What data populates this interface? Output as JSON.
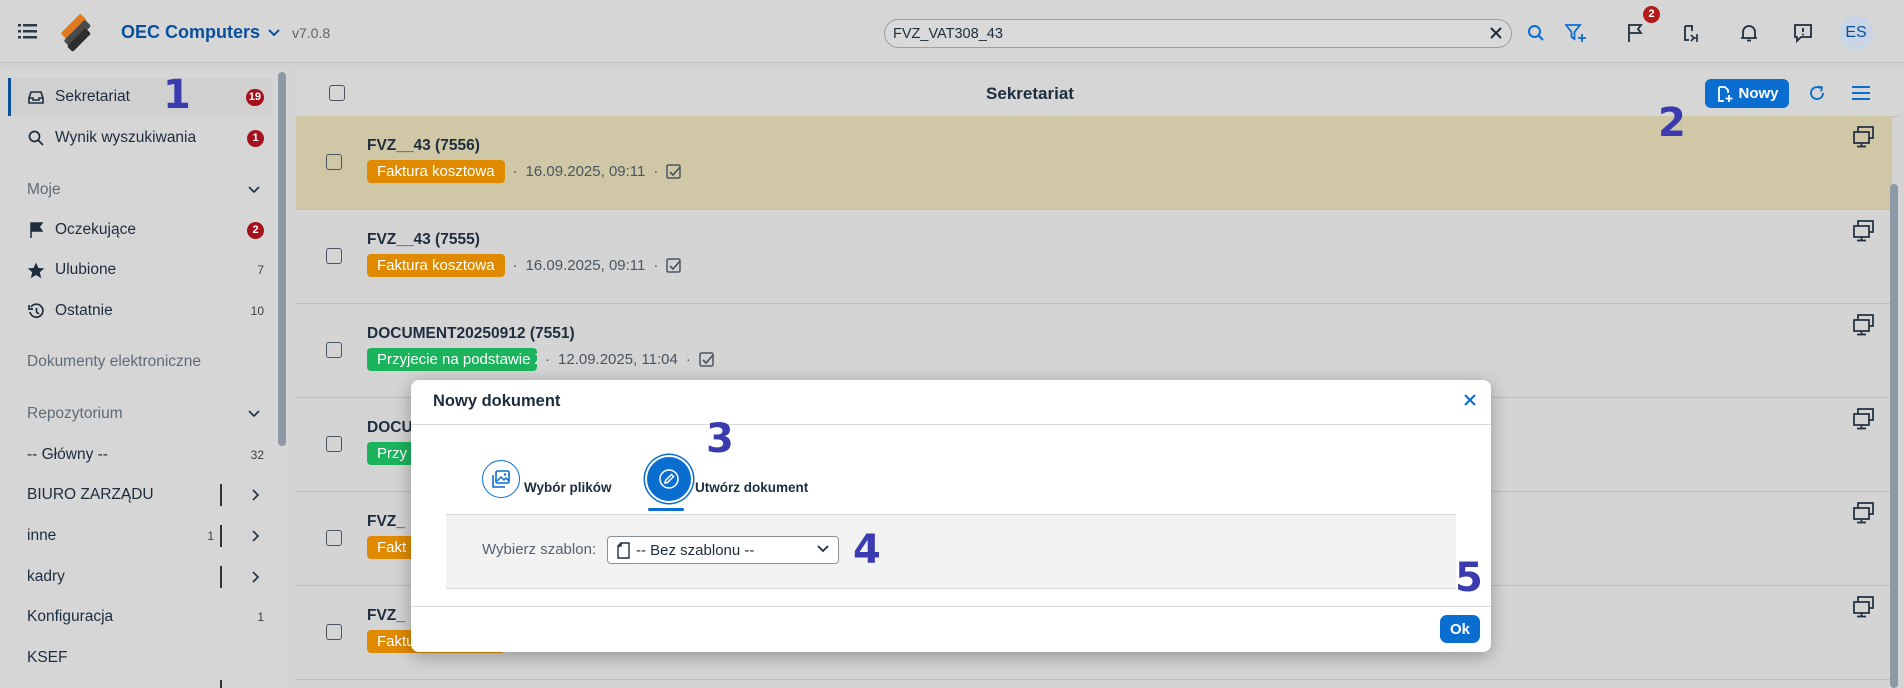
{
  "topbar": {
    "company": "OEC Computers",
    "version": "v7.0.8",
    "search_value": "FVZ_VAT308_43",
    "notification_badge": "2",
    "avatar": "ES",
    "icons": [
      "menu-list-icon",
      "app-logo-icon",
      "chevron-down-icon",
      "clear-icon",
      "search-icon",
      "filter-add-icon",
      "flag-icon",
      "process-icon",
      "bell-icon",
      "feedback-icon"
    ]
  },
  "sidebar": {
    "items": [
      {
        "label": "Sekretariat",
        "badge": "19"
      },
      {
        "label": "Wynik wyszukiwania",
        "badge": "1"
      },
      {
        "label": "Moje"
      },
      {
        "label": "Oczekujące",
        "badge": "2"
      },
      {
        "label": "Ulubione",
        "count": "7"
      },
      {
        "label": "Ostatnie",
        "count": "10"
      },
      {
        "label": "Dokumenty elektroniczne"
      },
      {
        "label": "Repozytorium"
      },
      {
        "label": "-- Główny --",
        "count": "32"
      },
      {
        "label": "BIURO ZARZĄDU"
      },
      {
        "label": "inne",
        "count": "1"
      },
      {
        "label": "kadry"
      },
      {
        "label": "Konfiguracja",
        "count": "1"
      },
      {
        "label": "KSEF"
      }
    ]
  },
  "main": {
    "title": "Sekretariat",
    "new_button": "Nowy",
    "rows": [
      {
        "title": "FVZ__43 (7556)",
        "tag": "Faktura kosztowa",
        "date": "16.09.2025, 09:11"
      },
      {
        "title": "FVZ__43 (7555)",
        "tag": "Faktura kosztowa",
        "date": "16.09.2025, 09:11"
      },
      {
        "title": "DOCUMENT20250912 (7551)",
        "tag": "Przyjecie na podstawie Zam...",
        "date": "12.09.2025, 11:04"
      },
      {
        "title": "DOCU",
        "tag": "Przy"
      },
      {
        "title": "FVZ_",
        "tag": "Fakt"
      },
      {
        "title": "FVZ_",
        "tag": "Faktura kosztowa"
      }
    ],
    "separator": "·"
  },
  "dialog": {
    "title": "Nowy dokument",
    "tabs": [
      {
        "label": "Wybór plików"
      },
      {
        "label": "Utwórz dokument"
      }
    ],
    "template_label": "Wybierz szablon:",
    "template_value": "-- Bez szablonu --",
    "ok": "Ok"
  },
  "annotations": [
    "1",
    "2",
    "3",
    "4",
    "5"
  ],
  "colors": {
    "accent": "#0a6ed1",
    "brand": "#0a4f9c",
    "badge": "#a5121f",
    "tag_orange": "#e08a00",
    "tag_green": "#1bb45c",
    "selected_row": "#cfc7a6",
    "annotation": "#3b3bb0"
  }
}
